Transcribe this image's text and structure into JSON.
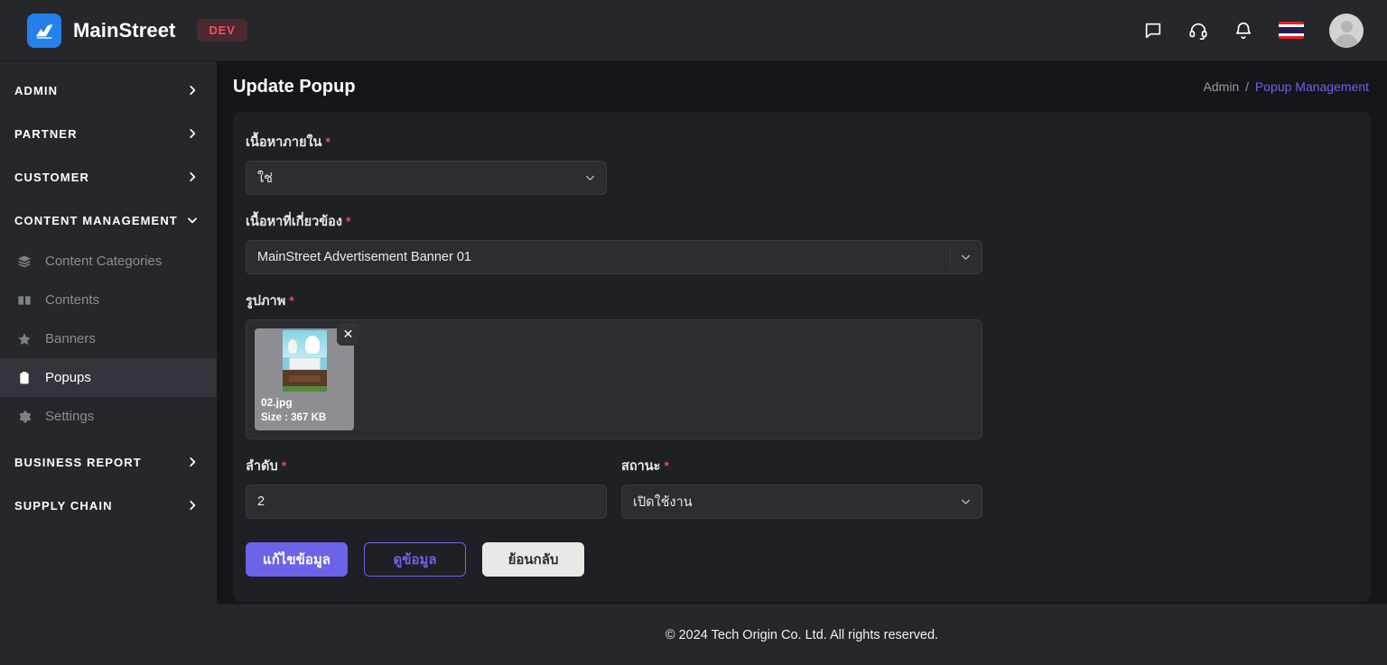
{
  "topbar": {
    "brand": "MainStreet",
    "badge": "DEV",
    "logo_color": "#2680eb",
    "badge_color": "#f0515f",
    "icons": [
      {
        "name": "chat-icon"
      },
      {
        "name": "headset-support-icon"
      },
      {
        "name": "notification-bell-icon"
      },
      {
        "name": "thai-flag-icon"
      },
      {
        "name": "user-avatar"
      }
    ]
  },
  "sidebar": {
    "groups": [
      {
        "label": "ADMIN",
        "expanded": false
      },
      {
        "label": "PARTNER",
        "expanded": false
      },
      {
        "label": "CUSTOMER",
        "expanded": false
      },
      {
        "label": "CONTENT MANAGEMENT",
        "expanded": true
      }
    ],
    "items": [
      {
        "label": "Content Categories",
        "icon": "layers-icon",
        "active": false
      },
      {
        "label": "Contents",
        "icon": "book-icon",
        "active": false
      },
      {
        "label": "Banners",
        "icon": "star-icon",
        "active": false
      },
      {
        "label": "Popups",
        "icon": "clipboard-icon",
        "active": true
      },
      {
        "label": "Settings",
        "icon": "gear-icon",
        "active": false
      }
    ],
    "groups_bottom": [
      {
        "label": "BUSINESS REPORT",
        "expanded": false
      },
      {
        "label": "SUPPLY CHAIN",
        "expanded": false
      }
    ],
    "active_highlight": "#34353c"
  },
  "page": {
    "title": "Update Popup",
    "breadcrumb": {
      "root": "Admin",
      "separator": "/",
      "current": "Popup Management",
      "current_color": "#6c63e8"
    }
  },
  "form": {
    "required_mark": "*",
    "internal_content": {
      "label": "เนื้อหาภายใน",
      "value": "ใช่"
    },
    "related_content": {
      "label": "เนื้อหาที่เกี่ยวข้อง",
      "value": "MainStreet Advertisement Banner 01"
    },
    "image": {
      "label": "รูปภาพ",
      "file_name": "02.jpg",
      "file_size": "Size : 367 KB",
      "remove_label": "✕"
    },
    "order": {
      "label": "ลำดับ",
      "value": "2"
    },
    "status": {
      "label": "สถานะ",
      "value": "เปิดใช้งาน"
    },
    "buttons": {
      "submit": "แก้ไขข้อมูล",
      "view": "ดูข้อมูล",
      "back": "ย้อนกลับ",
      "primary_color": "#6c63e8"
    }
  },
  "footer": {
    "text": "© 2024 Tech Origin Co. Ltd. All rights reserved."
  }
}
